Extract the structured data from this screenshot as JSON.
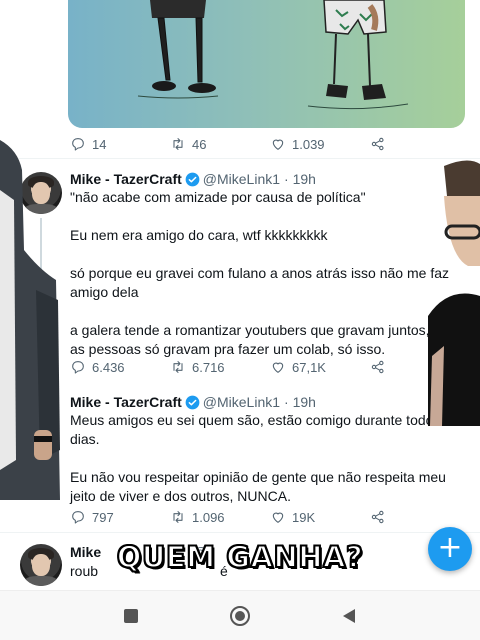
{
  "tweets": [
    {
      "id": "top",
      "actions": {
        "replies": "14",
        "retweets": "46",
        "likes": "1.039"
      }
    },
    {
      "id": "t1",
      "author": "Mike - TazerCraft",
      "handle": "@MikeLink1",
      "time": "· 19h",
      "paragraphs": [
        "\"não acabe com amizade por causa de política\"",
        "Eu nem era amigo do cara, wtf kkkkkkkkk",
        "só porque eu gravei com fulano a anos atrás isso não me faz amigo dela",
        "a galera tende a romantizar youtubers que gravam juntos, vezes as pessoas só gravam pra fazer um colab, só isso."
      ],
      "actions": {
        "replies": "6.436",
        "retweets": "6.716",
        "likes": "67,1K"
      }
    },
    {
      "id": "t2",
      "author": "Mike - TazerCraft",
      "handle": "@MikeLink1",
      "time": "· 19h",
      "paragraphs": [
        "Meus amigos eu sei quem são, estão comigo durante todos os dias.",
        "Eu não vou respeitar opinião de gente que não respeita meu jeito de viver e dos outros, NUNCA."
      ],
      "actions": {
        "replies": "797",
        "retweets": "1.096",
        "likes": "19K"
      }
    },
    {
      "id": "t3",
      "author": "Mike",
      "handle": "@",
      "time": "",
      "paragraphs": [
        "roub",
        "é"
      ]
    }
  ],
  "caption": "QUEM GANHA?",
  "fab_label": "+",
  "colors": {
    "accent": "#1d9bf0",
    "verified": "#1d9bf0",
    "muted": "#536471"
  },
  "icons": [
    "reply-icon",
    "retweet-icon",
    "like-icon",
    "share-icon",
    "verified-badge-icon",
    "compose-icon",
    "recent-apps-icon",
    "home-icon",
    "back-icon"
  ]
}
